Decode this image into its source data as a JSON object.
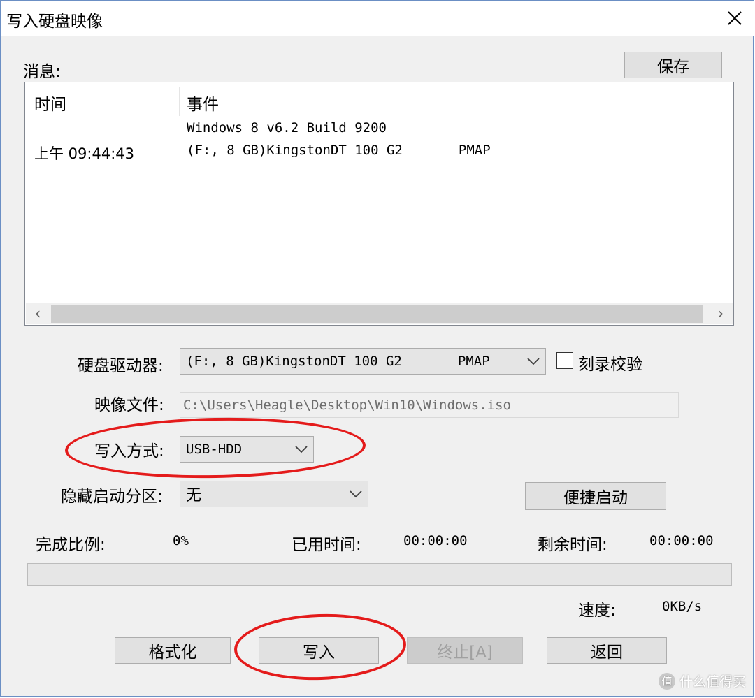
{
  "window": {
    "title": "写入硬盘映像"
  },
  "messages": {
    "label": "消息:",
    "save_button": "保存",
    "columns": [
      "时间",
      "事件"
    ],
    "rows": [
      {
        "time": "",
        "event": "Windows 8 v6.2 Build 9200"
      },
      {
        "time": "上午 09:44:43",
        "event": "(F:, 8 GB)KingstonDT 100 G2       PMAP"
      }
    ]
  },
  "form": {
    "drive_label": "硬盘驱动器:",
    "drive_value": "(F:, 8 GB)KingstonDT 100 G2       PMAP",
    "verify_label": "刻录校验",
    "verify_checked": false,
    "image_label": "映像文件:",
    "image_value": "C:\\Users\\Heagle\\Desktop\\Win10\\Windows.iso",
    "write_mode_label": "写入方式:",
    "write_mode_value": "USB-HDD",
    "hidden_partition_label": "隐藏启动分区:",
    "hidden_partition_value": "无",
    "quick_boot_button": "便捷启动"
  },
  "status": {
    "progress_label": "完成比例:",
    "progress_value": "0%",
    "progress_fraction": 0,
    "elapsed_label": "已用时间:",
    "elapsed_value": "00:00:00",
    "remaining_label": "剩余时间:",
    "remaining_value": "00:00:00",
    "speed_label": "速度:",
    "speed_value": "0KB/s"
  },
  "buttons": {
    "format": "格式化",
    "write": "写入",
    "abort": "终止[A]",
    "back": "返回"
  },
  "watermark": {
    "badge": "值",
    "text": "什么值得买"
  },
  "colors": {
    "highlight_ellipse": "#e41b1b",
    "window_border": "#6b8fc4"
  }
}
